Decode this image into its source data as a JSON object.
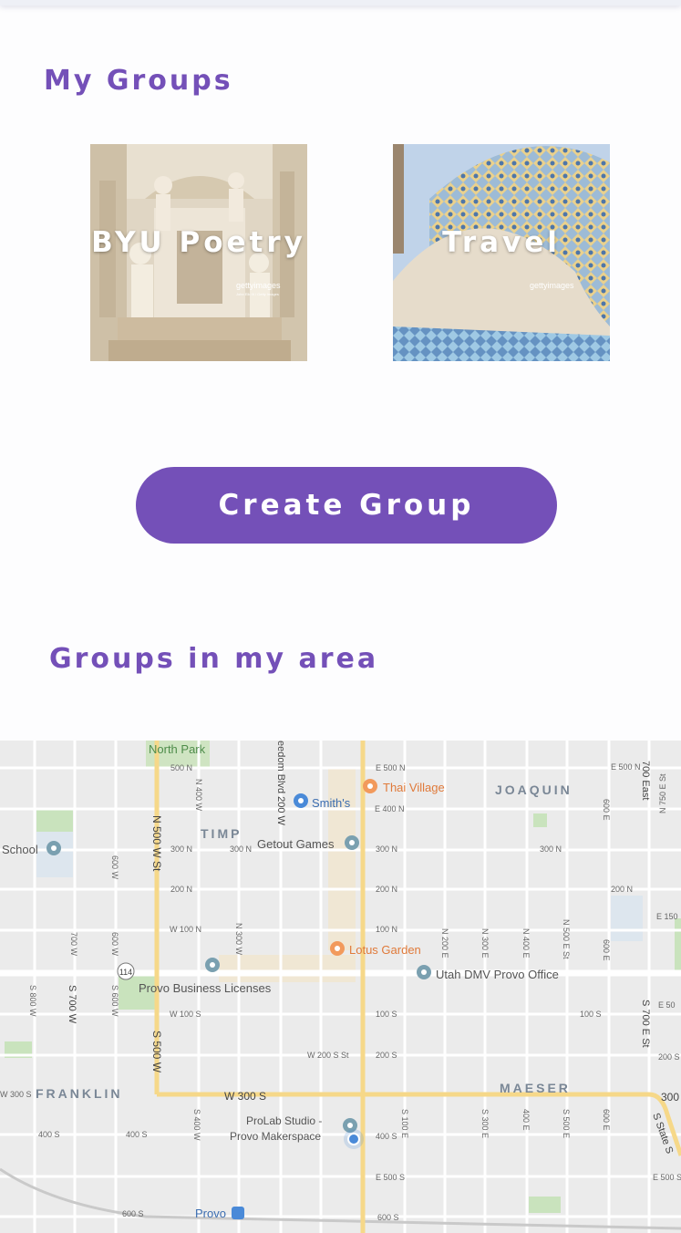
{
  "sections": {
    "my_groups_title": "My Groups",
    "area_title": "Groups in my area"
  },
  "groups": [
    {
      "label": "BYU Poetry",
      "watermark": "gettyimages",
      "credit": "John Elk III / Getty Images"
    },
    {
      "label": "Travel",
      "watermark": "gettyimages",
      "credit": ""
    }
  ],
  "create_button": {
    "label": "Create Group"
  },
  "colors": {
    "accent": "#7450b8",
    "map_bg": "#ebebeb",
    "map_highway": "#f6d889"
  },
  "map": {
    "places": {
      "north_park": "North Park",
      "thai_village": "Thai Village",
      "smiths": "Smith's",
      "joaquin": "JOAQUIN",
      "timp": "TIMP",
      "getout_games": "Getout Games",
      "school": "School",
      "lotus_garden": "Lotus Garden",
      "provo_business_licenses": "Provo Business Licenses",
      "utah_dmv": "Utah DMV Provo Office",
      "franklin": "FRANKLIN",
      "maeser": "MAESER",
      "prolab_1": "ProLab Studio -",
      "prolab_2": "Provo Makerspace",
      "provo": "Provo"
    },
    "streets": {
      "freedom_blvd": "eedom Blvd 200 W",
      "n500w": "N 500 W St",
      "s500w": "S 500 W",
      "w300s": "W 300 S",
      "s700e": "S 700 E St",
      "e700e": "700 East",
      "s700w": "S 700 W",
      "s800w": "S 800 W",
      "state_st": "S State S",
      "route_114": "114",
      "e500n_a": "E 500 N",
      "e500n_b": "E 500 N",
      "n500n": "500 N",
      "e400n": "E 400 N",
      "n300n_a": "300 N",
      "n300n_b": "300 N",
      "n300n_c": "300 N",
      "n300n_d": "300 N",
      "n200n_a": "200 N",
      "n200n_b": "200 N",
      "n200n_c": "200 N",
      "w100n": "W 100 N",
      "n100n": "100 N",
      "w100s": "W 100 S",
      "s100s_a": "100 S",
      "s100s_b": "100 S",
      "w200s": "W 200 S St",
      "s200s_a": "200 S",
      "s200s_b": "200 S",
      "w300s_left": "W 300 S",
      "s300_right": "300",
      "s400s_a": "400 S",
      "s400s_b": "400 S",
      "s400s_c": "400 S",
      "s500s_a": "E 500 S",
      "s500s_b": "E 500 S",
      "s600s_a": "600 S",
      "s600s_b": "600 S",
      "e150": "E 150",
      "e50": "E 50",
      "n400w": "N 400 W",
      "n300w": "N 300 W",
      "n600w": "600 W",
      "n600w_b": "600 W",
      "n700w": "700 W",
      "s600w": "S 600 W",
      "s400w": "S 400 W",
      "n200e": "N 200 E",
      "n300e": "N 300 E",
      "n400e": "N 400 E",
      "n500e": "N 500 E St",
      "n600e": "600 E",
      "e600e_a": "600 E",
      "s100e": "S 100 E",
      "s300e": "S 300 E",
      "s400e": "400 E",
      "s500e": "S 500 E",
      "s600e": "600 E",
      "n750e": "N 750 E St"
    }
  }
}
